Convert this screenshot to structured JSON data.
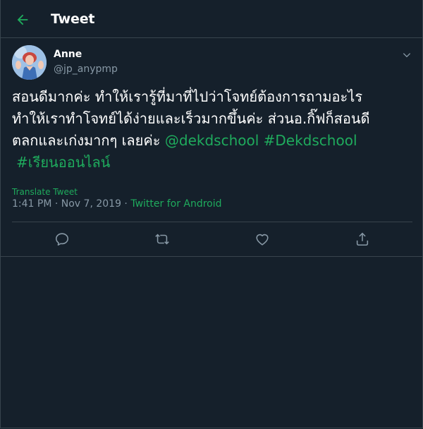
{
  "header": {
    "title": "Tweet"
  },
  "tweet": {
    "author_name": "Anne",
    "handle": "@jp_anypmp",
    "text_line1": "สอนดีมากค่ะ ทำให้เรารู้ที่มาที่ไปว่าโจทย์ต้องการถามอะไร",
    "text_line2": "ทำให้เราทำโจทย์ได้ง่ายและเร็วมากขึ้นค่ะ ส่วนอ.กิ๊ฟก็สอนดี",
    "text_line3": "ตลกและเก่งมากๆ เลยค่ะ",
    "mention": "@dekdschool",
    "hashtag1": "#Dekdschool",
    "hashtag2": "#เรียนออนไลน์",
    "translate_label": "Translate Tweet",
    "timestamp": "1:41 PM · Nov 7, 2019 · ",
    "source": "Twitter for Android"
  },
  "icons": {
    "back": "arrow-left-icon",
    "caret": "chevron-down-icon",
    "reply": "reply-icon",
    "retweet": "retweet-icon",
    "like": "heart-icon",
    "share": "share-icon"
  },
  "colors": {
    "background": "#15202b",
    "accent": "#1fab5d",
    "muted": "#8899a6",
    "border": "#38444d"
  }
}
